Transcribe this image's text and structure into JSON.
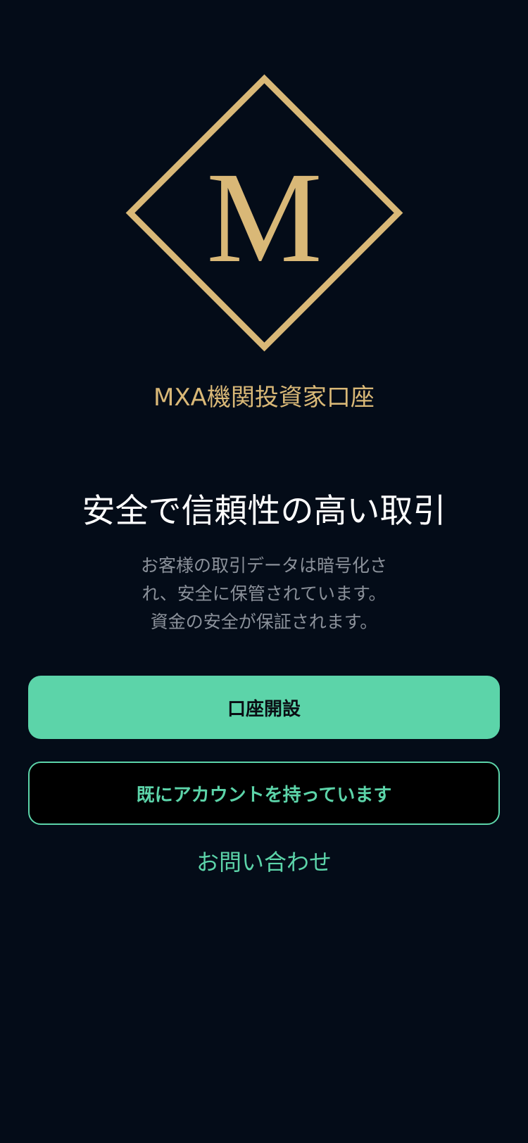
{
  "brand": {
    "logo_icon": "diamond-m-logo-icon",
    "name": "MXA機関投資家口座"
  },
  "hero": {
    "headline": "安全で信頼性の高い取引",
    "description_line1": "お客様の取引データは暗号化さ",
    "description_line2": "れ、安全に保管されています。",
    "description_line3": "資金の安全が保証されます。"
  },
  "actions": {
    "open_account_label": "口座開設",
    "have_account_label": "既にアカウントを持っています",
    "contact_label": "お問い合わせ"
  },
  "colors": {
    "background": "#040c18",
    "gold": "#d9b877",
    "accent": "#5cd4a9",
    "muted_text": "#8b919a"
  }
}
